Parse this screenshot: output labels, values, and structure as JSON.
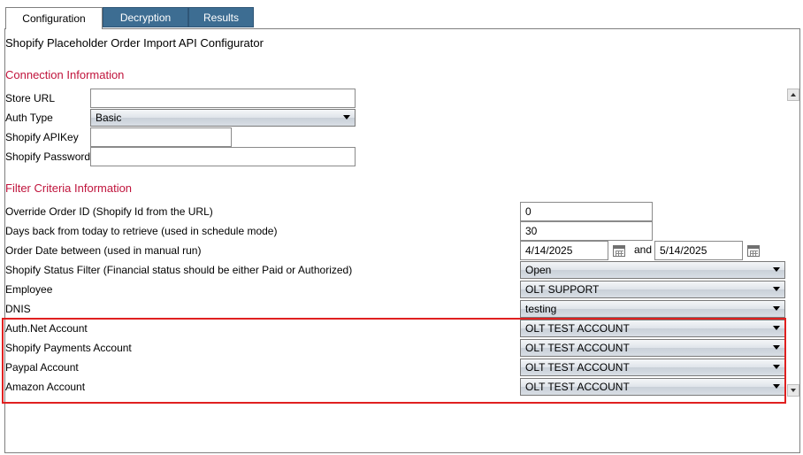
{
  "tabs": {
    "configuration": "Configuration",
    "decryption": "Decryption",
    "results": "Results"
  },
  "page_title": "Shopify Placeholder Order Import API Configurator",
  "connection": {
    "heading": "Connection Information",
    "store_url_label": "Store URL",
    "store_url_value": "",
    "auth_type_label": "Auth Type",
    "auth_type_value": "Basic",
    "api_key_label": "Shopify APIKey",
    "api_key_value": "",
    "password_label": "Shopify Password",
    "password_value": ""
  },
  "filter": {
    "heading": "Filter Criteria Information",
    "override_label": "Override Order ID (Shopify Id from the URL)",
    "override_value": "0",
    "days_back_label": "Days back from today to retrieve (used in schedule mode)",
    "days_back_value": "30",
    "order_date_label": "Order Date between (used in manual run)",
    "date_from": "4/14/2025",
    "and_label": "and",
    "date_to": "5/14/2025",
    "status_label": "Shopify Status Filter (Financial status should be either Paid or Authorized)",
    "status_value": "Open",
    "employee_label": "Employee",
    "employee_value": "OLT SUPPORT",
    "dnis_label": "DNIS",
    "dnis_value": "testing",
    "authnet_label": "Auth.Net Account",
    "authnet_value": "OLT TEST ACCOUNT",
    "shopify_payments_label": "Shopify Payments Account",
    "shopify_payments_value": "OLT TEST ACCOUNT",
    "paypal_label": "Paypal Account",
    "paypal_value": "OLT TEST ACCOUNT",
    "amazon_label": "Amazon Account",
    "amazon_value": "OLT TEST ACCOUNT"
  },
  "colors": {
    "section_heading": "#c0143c",
    "tab_inactive": "#3d6d92",
    "highlight": "#e02020"
  }
}
